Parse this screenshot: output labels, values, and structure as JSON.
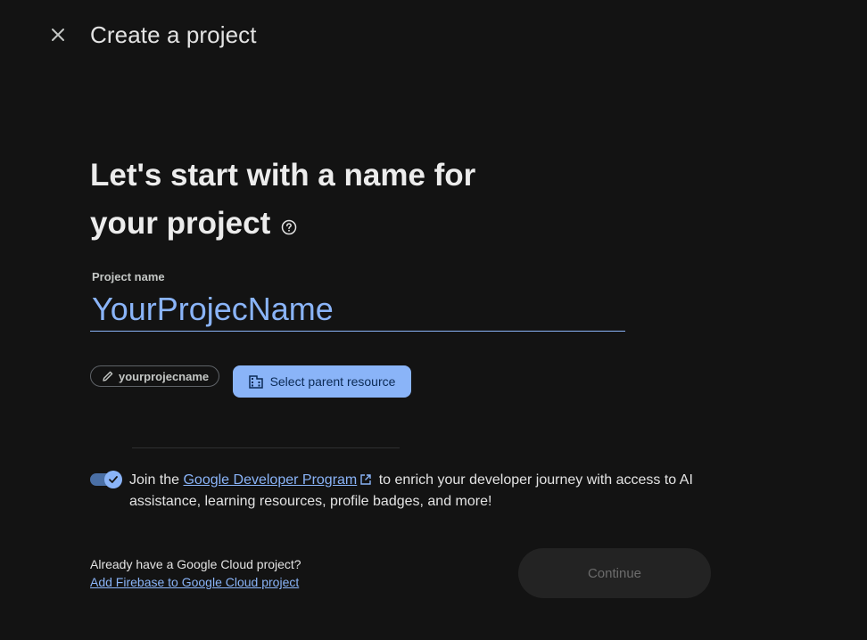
{
  "header": {
    "title": "Create a project",
    "close_icon": "close-icon"
  },
  "main": {
    "heading_line1": "Let's start with a name for",
    "heading_line2": "your project",
    "help_icon": "help-circle-icon",
    "project_name_label": "Project name",
    "project_name_value": "YourProjecName",
    "project_id_chip": "yourprojecname",
    "select_parent_label": "Select parent resource"
  },
  "developer_program": {
    "enabled": true,
    "text_before": "Join the ",
    "link_text": "Google Developer Program",
    "text_after": " to enrich your developer journey with access to AI assistance, learning resources, profile badges, and more!"
  },
  "footer": {
    "already_text": "Already have a Google Cloud project?",
    "firebase_link": "Add Firebase to Google Cloud project",
    "continue_label": "Continue"
  },
  "colors": {
    "background": "#131313",
    "accent": "#8ab4f8",
    "text": "#e3e3e3"
  }
}
